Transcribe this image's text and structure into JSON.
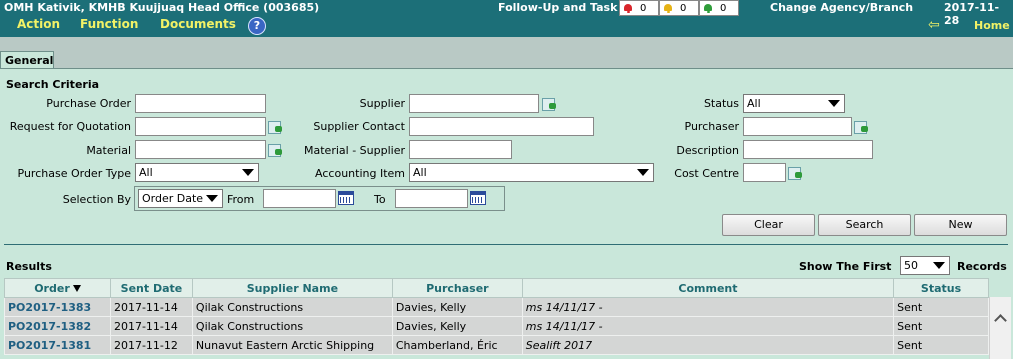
{
  "header": {
    "agency": "OMH Kativik, KMHB Kuujjuaq Head Office (003685)",
    "menu": [
      "Action",
      "Function",
      "Documents"
    ],
    "help": "?",
    "followup_label": "Follow-Up and Task",
    "counters": [
      {
        "icon": "red-bell-icon",
        "color": "#d9262b",
        "count": "0"
      },
      {
        "icon": "yellow-bell-icon",
        "color": "#e6b316",
        "count": "0"
      },
      {
        "icon": "green-bell-icon",
        "color": "#2f9d3a",
        "count": "0"
      }
    ],
    "change_agency": "Change Agency/Branch",
    "date": "2017-11-28",
    "back_icon": "⇦",
    "home": "Home"
  },
  "tabs": [
    "General"
  ],
  "search": {
    "title": "Search Criteria",
    "purchase_order": {
      "label": "Purchase Order",
      "value": ""
    },
    "rfq": {
      "label": "Request for Quotation",
      "value": ""
    },
    "material": {
      "label": "Material",
      "value": ""
    },
    "po_type": {
      "label": "Purchase Order Type",
      "value": "All"
    },
    "selection_by": {
      "label": "Selection By",
      "value": "Order Date"
    },
    "from": {
      "label": "From",
      "value": ""
    },
    "to": {
      "label": "To",
      "value": ""
    },
    "supplier": {
      "label": "Supplier",
      "value": ""
    },
    "supplier_contact": {
      "label": "Supplier Contact",
      "value": ""
    },
    "material_supplier": {
      "label": "Material - Supplier",
      "value": ""
    },
    "accounting_item": {
      "label": "Accounting Item",
      "value": "All"
    },
    "status": {
      "label": "Status",
      "value": "All"
    },
    "purchaser": {
      "label": "Purchaser",
      "value": ""
    },
    "description": {
      "label": "Description",
      "value": ""
    },
    "cost_centre": {
      "label": "Cost Centre",
      "value": ""
    }
  },
  "buttons": {
    "clear": "Clear",
    "search": "Search",
    "new": "New"
  },
  "results": {
    "title": "Results",
    "show_first_label": "Show The First",
    "show_first_value": "50",
    "records_label": "Records",
    "columns": [
      "Order",
      "Sent Date",
      "Supplier Name",
      "Purchaser",
      "Comment",
      "Status"
    ],
    "rows": [
      {
        "order": "PO2017-1383",
        "sent_date": "2017-11-14",
        "supplier": "Qilak Constructions",
        "purchaser": "Davies, Kelly",
        "comment": "ms 14/11/17 -",
        "status": "Sent"
      },
      {
        "order": "PO2017-1382",
        "sent_date": "2017-11-14",
        "supplier": "Qilak Constructions",
        "purchaser": "Davies, Kelly",
        "comment": "ms 14/11/17 -",
        "status": "Sent"
      },
      {
        "order": "PO2017-1381",
        "sent_date": "2017-11-12",
        "supplier": "Nunavut Eastern Arctic Shipping",
        "purchaser": "Chamberland, Éric",
        "comment": "Sealift 2017",
        "status": "Sent"
      }
    ]
  }
}
